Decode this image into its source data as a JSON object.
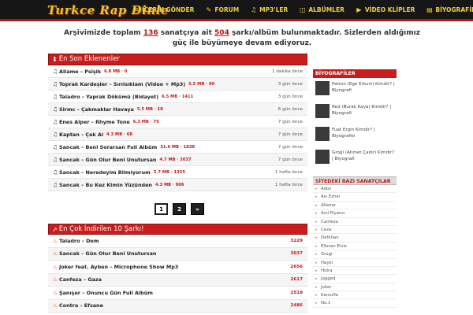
{
  "header": {
    "logo": "Turkce Rap Dinle",
    "nav": [
      {
        "icon": "comment-icon",
        "label": "İÇERİK GÖNDER"
      },
      {
        "icon": "chat-icon",
        "label": "FORUM"
      },
      {
        "icon": "music-icon",
        "label": "MP3'LER"
      },
      {
        "icon": "folder-icon",
        "label": "ALBÜMLER"
      },
      {
        "icon": "video-icon",
        "label": "VİDEO KLİPLER"
      },
      {
        "icon": "book-icon",
        "label": "BİYOGRAFİLER"
      }
    ]
  },
  "intro": {
    "pre": "Arşivimizde toplam ",
    "artists": "136",
    "mid": " sanatçıya ait ",
    "songs": "504",
    "post": " şarkı/albüm bulunmaktadır. Sizlerden aldığımız güç ile büyümeye devam ediyoruz."
  },
  "latest": {
    "title": "En Son Eklenenler",
    "rows": [
      {
        "title": "Allame – Psişik",
        "meta": "6.8 MB · 0",
        "time": "1 dakika önce"
      },
      {
        "title": "Toprak Kardeşler – Sırılsıklam (Video + Mp3)",
        "meta": "5.5 MB · 90",
        "time": "3 gün önce"
      },
      {
        "title": "Taladro – Yaprak Dökümü (Bidayet)",
        "meta": "6.5 MB · 1411",
        "time": "3 gün önce"
      },
      {
        "title": "Sirmc – Çakmaklar Havaya",
        "meta": "5.5 MB · 18",
        "time": "6 gün önce"
      },
      {
        "title": "Enes Alper – Rhyme Tone",
        "meta": "6.3 MB · 75",
        "time": "7 gün önce"
      },
      {
        "title": "Kaptan – Çek Al",
        "meta": "4.3 MB · 68",
        "time": "7 gün önce"
      },
      {
        "title": "Sancak – Beni Sorarsan Full Albüm",
        "meta": "31.6 MB · 1838",
        "time": "7 gün önce"
      },
      {
        "title": "Sancak – Gün Olur Beni Unutursan",
        "meta": "4.7 MB · 3037",
        "time": "7 gün önce"
      },
      {
        "title": "Sancak – Neredeyim Bilmiyorum",
        "meta": "5.7 MB · 1355",
        "time": "1 hafta önce"
      },
      {
        "title": "Sancak – Bu Kez Kimin Yüzünden",
        "meta": "4.3 MB · 906",
        "time": "1 hafta önce"
      }
    ]
  },
  "pagination": {
    "pages": [
      "1",
      "2",
      "»"
    ],
    "active": "1"
  },
  "top": {
    "title": "En Çok İndirilen 10 Şarkı!",
    "rows": [
      {
        "title": "Taladro – Dem",
        "count": "3229"
      },
      {
        "title": "Sancak – Gün Olur Beni Unutursan",
        "count": "3037"
      },
      {
        "title": "Joker feat. Ayben – Microphone Show Mp3",
        "count": "2656"
      },
      {
        "title": "Canfeza – Gaza",
        "count": "2617"
      },
      {
        "title": "Şanışer – Onuncu Gün Full Albüm",
        "count": "2519"
      },
      {
        "title": "Contra – Efsane",
        "count": "2486"
      }
    ]
  },
  "sidebar": {
    "bio_title": "BİYOGRAFİLER",
    "bios": [
      {
        "text": "Patron (Ege Erkurt) Kimdir? | Biyografi"
      },
      {
        "text": "Red (Burak Kaya) Kimdir? | Biyografi"
      },
      {
        "text": "Fuat Ergin Kimdir? | Biyografisi"
      },
      {
        "text": "Grogi (Ahmet Çadır) Kimdir? | Biyografi"
      }
    ],
    "artists_title": "SİTEDEKİ BAZI SANATÇILAR",
    "artists": [
      "Ados",
      "Ais Ezhel",
      "Allame",
      "Anıl Piyancı",
      "Canfeza",
      "Ceza",
      "Defkhan",
      "Elleran Elvis",
      "Grogi",
      "Hayki",
      "Hidra",
      "Jagged",
      "Joker",
      "Kamufle",
      "No.1"
    ]
  }
}
